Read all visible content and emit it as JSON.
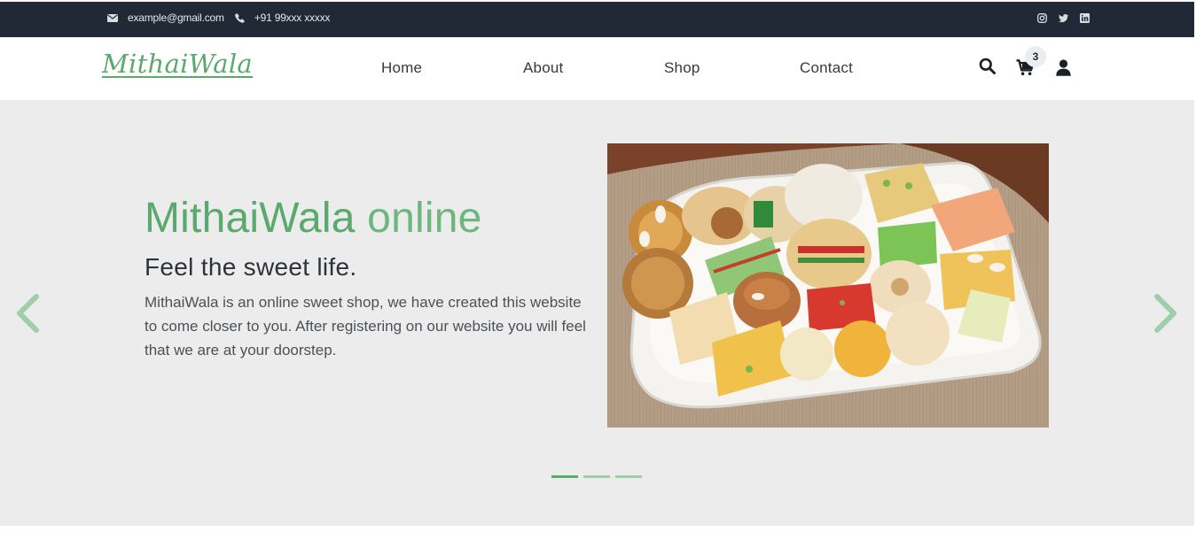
{
  "topbar": {
    "email": "example@gmail.com",
    "phone": "+91 99xxx xxxxx",
    "icons": [
      "mail-icon",
      "phone-icon",
      "instagram-icon",
      "twitter-icon",
      "linkedin-icon"
    ]
  },
  "navbar": {
    "logo": "MithaiWala",
    "links": [
      "Home",
      "About",
      "Shop",
      "Contact"
    ],
    "cart_count": "3",
    "icons": [
      "search-icon",
      "cart-icon",
      "user-icon"
    ]
  },
  "hero": {
    "title_bold": "MithaiWala",
    "title_light": "online",
    "subtitle": "Feel the sweet life.",
    "description": "MithaiWala is an online sweet shop, we have created this website to come closer to you. After registering on our website you will feel that we are at your doorstep.",
    "slide_count": 3,
    "active_slide": 1,
    "icons": [
      "chevron-left-icon",
      "chevron-right-icon"
    ]
  },
  "colors": {
    "topbar_bg": "#212936",
    "accent_green": "#5aa96d",
    "hero_bg": "#ececec"
  }
}
